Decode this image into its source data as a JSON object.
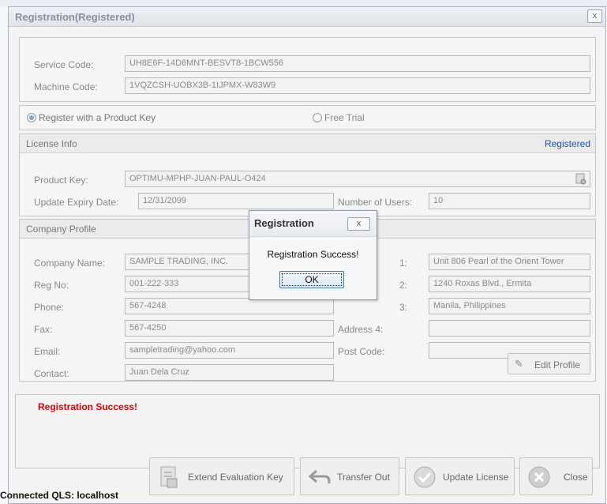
{
  "window": {
    "title": "Registration(Registered)",
    "close": "x"
  },
  "codes": {
    "service_label": "Service Code:",
    "service_value": "UH8E6F-14D6MNT-BESVT8-1BCW556",
    "machine_label": "Machine Code:",
    "machine_value": "1VQZCSH-UOBX3B-1IJPMX-W83W9"
  },
  "mode": {
    "register_label": "Register with a Product Key",
    "trial_label": "Free Trial"
  },
  "license": {
    "title": "License Info",
    "status": "Registered",
    "product_key_label": "Product Key:",
    "product_key": "OPTIMU-MPHP-JUAN-PAUL-O424",
    "expiry_label": "Update Expiry Date:",
    "expiry": "12/31/2099",
    "users_label": "Number of Users:",
    "users": "10"
  },
  "company": {
    "title": "Company Profile",
    "fields": [
      {
        "label": "Company Name:",
        "value": "SAMPLE TRADING, INC."
      },
      {
        "label": "Reg No:",
        "value": "001-222-333"
      },
      {
        "label": "Phone:",
        "value": "567-4248"
      },
      {
        "label": "Fax:",
        "value": "567-4250"
      },
      {
        "label": "Email:",
        "value": "sampletrading@yahoo.com"
      },
      {
        "label": "Contact:",
        "value": "Juan Dela Cruz"
      }
    ],
    "address": [
      {
        "label": "1:",
        "value": "Unit 806 Pearl of the Orient Tower"
      },
      {
        "label": "2:",
        "value": "1240 Roxas Blvd., Ermita"
      },
      {
        "label": "3:",
        "value": "Manila, Philippines"
      },
      {
        "label": "Address 4:",
        "value": ""
      },
      {
        "label": "Post Code:",
        "value": ""
      }
    ],
    "edit_profile": "Edit Profile"
  },
  "message": "Registration Success!",
  "buttons": {
    "extend": "Extend Evaluation Key",
    "transfer": "Transfer Out",
    "update": "Update License",
    "close": "Close"
  },
  "connection": "Connected QLS: localhost",
  "dialog": {
    "title": "Registration",
    "close": "x",
    "message": "Registration Success!",
    "ok": "OK"
  }
}
